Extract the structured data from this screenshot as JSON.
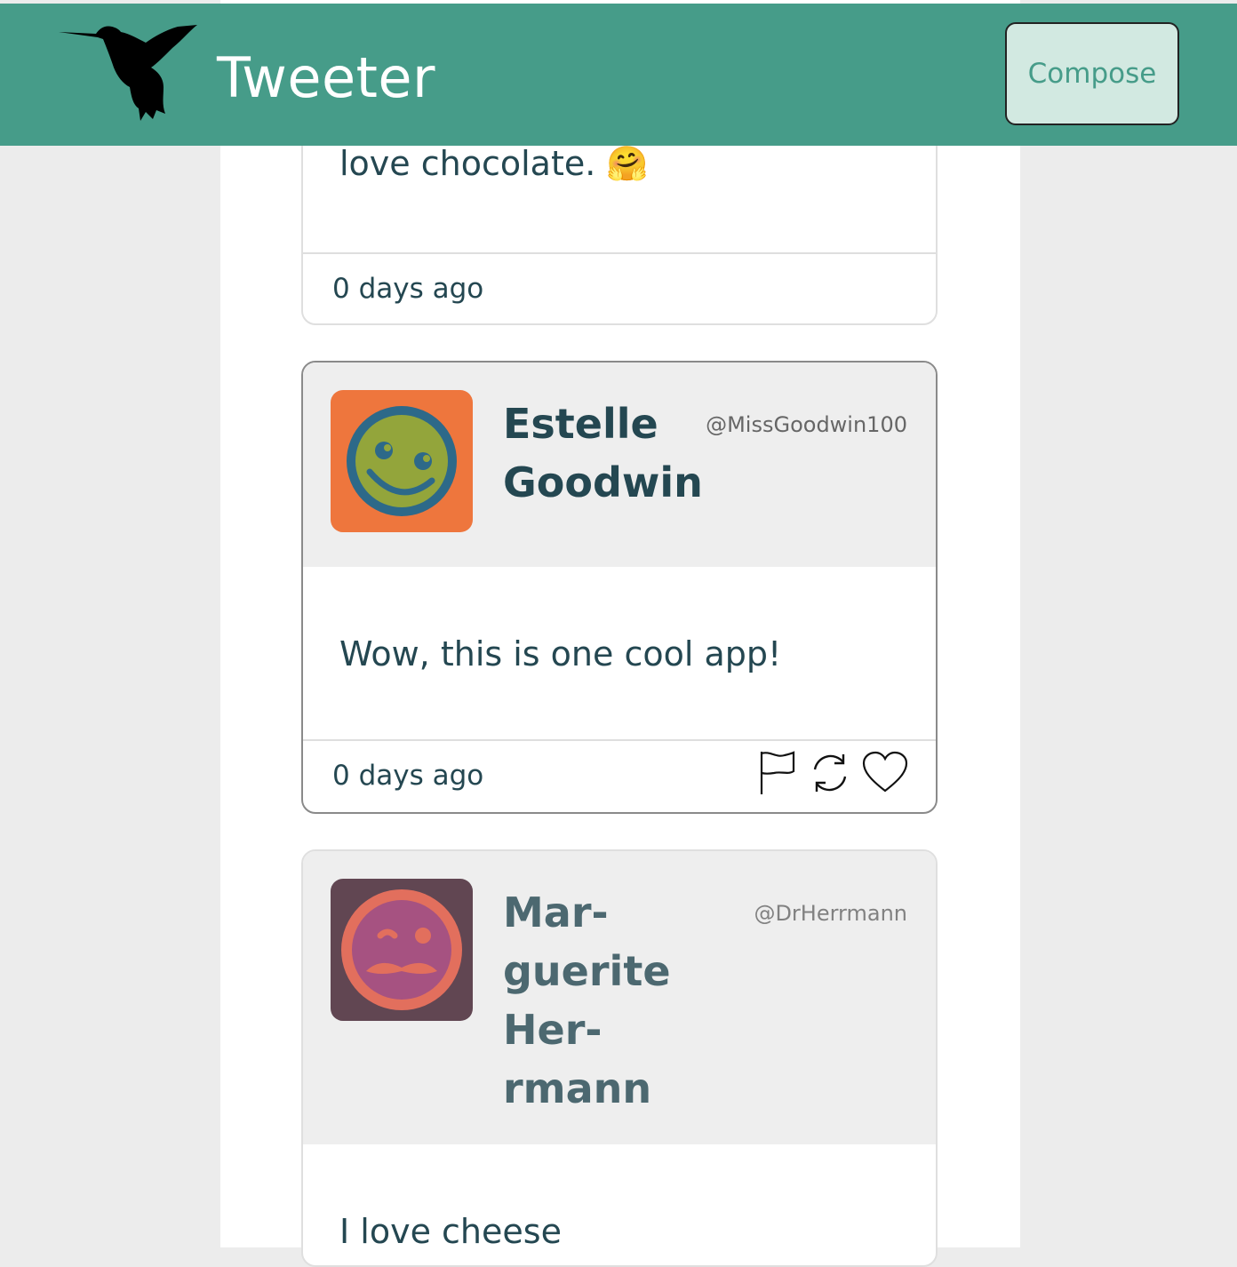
{
  "app": {
    "title": "Tweeter",
    "compose_label": "Compose"
  },
  "icons": {
    "logo": "hummingbird-icon",
    "flag": "flag-icon",
    "retweet": "retweet-icon",
    "like": "heart-icon"
  },
  "colors": {
    "brand": "#469c89",
    "compose_bg": "#d2e9e1",
    "text": "#244751"
  },
  "tweets": [
    {
      "content": "love chocolate. 🤗",
      "timestamp": "0 days ago"
    },
    {
      "name": "Estelle Goodwin",
      "handle": "@MissGoodwin100",
      "content": "Wow, this is one cool app!",
      "timestamp": "0 days ago"
    },
    {
      "name": "Mar-guerite Her-rmann",
      "handle": "@DrHerrmann",
      "content": "I love cheese"
    }
  ]
}
